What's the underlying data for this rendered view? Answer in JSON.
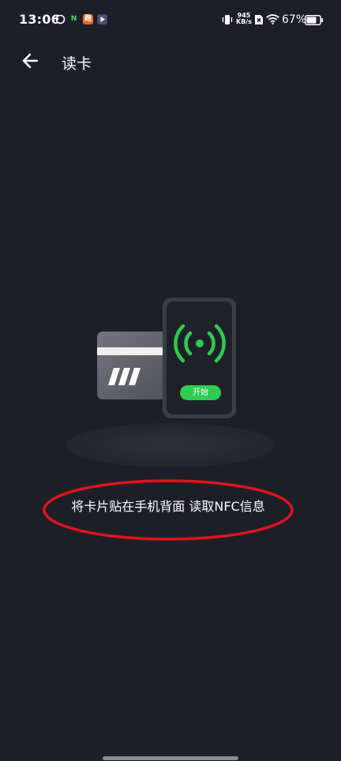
{
  "status_bar": {
    "time": "13:06",
    "speed_value": "945",
    "speed_unit": "KB/s",
    "battery_percent": "67%",
    "notif_icons": [
      "sync-icon",
      "n-app-icon",
      "orange-app-icon",
      "play-app-icon"
    ]
  },
  "nav": {
    "title": "读卡"
  },
  "illustration": {
    "start_label": "开始",
    "accent_color": "#2ecc52"
  },
  "main": {
    "instruction": "将卡片贴在手机背面 读取NFC信息"
  },
  "colors": {
    "background": "#1d1f27",
    "highlight": "#e0141e"
  }
}
